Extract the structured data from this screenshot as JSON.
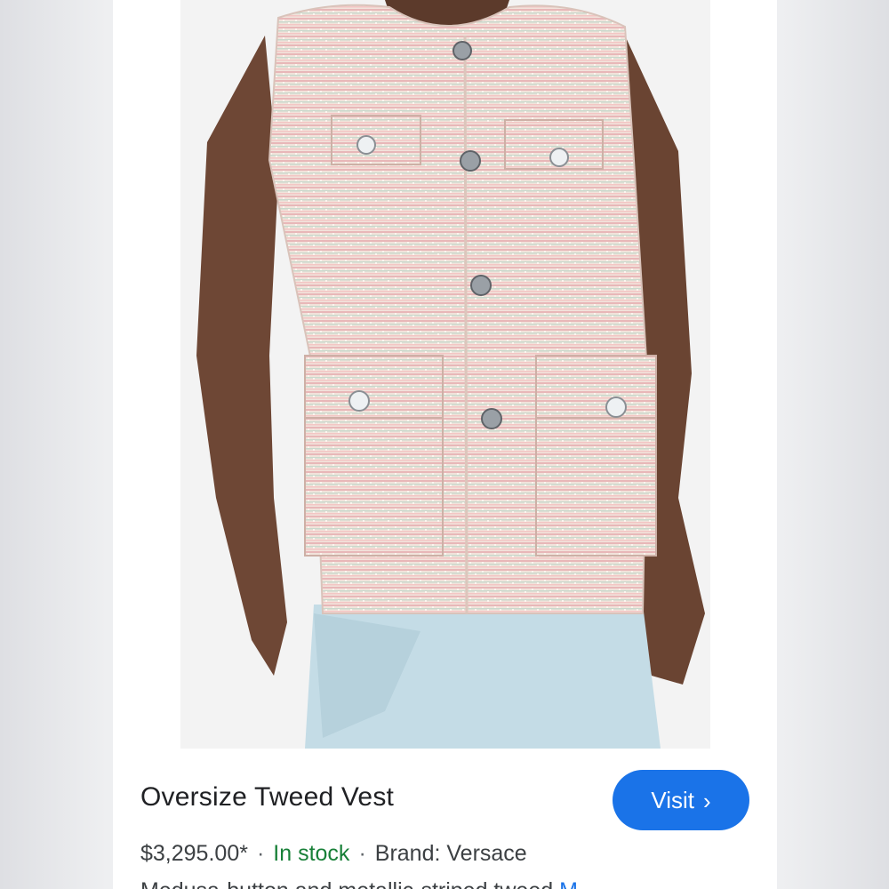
{
  "product": {
    "title": "Oversize Tweed Vest",
    "price": "$3,295.00*",
    "separator": "·",
    "stock_status": "In stock",
    "brand": "Brand: Versace",
    "description_partial": "Medusa-button and metallic-striped tweed",
    "description_more": "M"
  },
  "actions": {
    "visit_label": "Visit",
    "visit_icon": "chevron-right-icon"
  },
  "colors": {
    "accent": "#1a73e8",
    "in_stock": "#188038",
    "title_text": "#202124"
  }
}
